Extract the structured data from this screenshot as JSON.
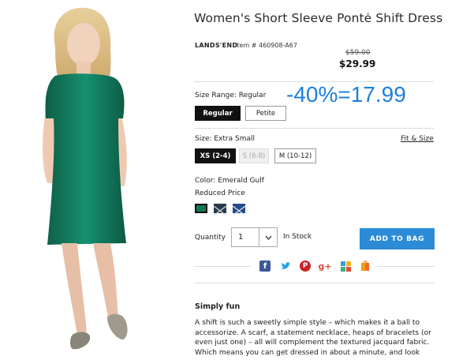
{
  "product": {
    "title": "Women's Short Sleeve Pontė Shift Dress",
    "brand": "LANDS'END",
    "item_number": "Item # 460908-A67",
    "price_original": "$59.00",
    "price_sale": "$29.99"
  },
  "overlay_text": "-40%=17.99",
  "size_range": {
    "label": "Size Range: Regular",
    "options": [
      {
        "label": "Regular",
        "state": "selected"
      },
      {
        "label": "Petite",
        "state": "available"
      }
    ]
  },
  "size": {
    "label": "Size: Extra Small",
    "fit_link": "Fit & Size",
    "options": [
      {
        "label": "XS (2-4)",
        "state": "selected"
      },
      {
        "label": "S (6-8)",
        "state": "disabled"
      },
      {
        "label": "M (10-12)",
        "state": "available"
      }
    ]
  },
  "color": {
    "label": "Color: Emerald Gulf",
    "price_note": "Reduced Price",
    "swatches": [
      "#13765a",
      "#283848",
      "#274a8a"
    ]
  },
  "quantity": {
    "label": "Quantity",
    "value": "1",
    "stock": "In Stock"
  },
  "add_to_bag": "ADD TO BAG",
  "social_icons": [
    "facebook-icon",
    "twitter-icon",
    "pinterest-icon",
    "google-plus-icon",
    "fancy-icon",
    "shopping-bag-share-icon"
  ],
  "description": {
    "heading": "Simply fun",
    "text": "A shift is such a sweetly simple style – which makes it a ball to accessorize. A scarf, a statement necklace, heaps of bracelets (or even just one) – all will complement the textured jacquard fabric. Which means you can get dressed in about a minute, and look"
  },
  "colors": {
    "accent_blue": "#2c8bd6",
    "overlay_blue": "#1c7fe0",
    "dress_green": "#13765a"
  }
}
